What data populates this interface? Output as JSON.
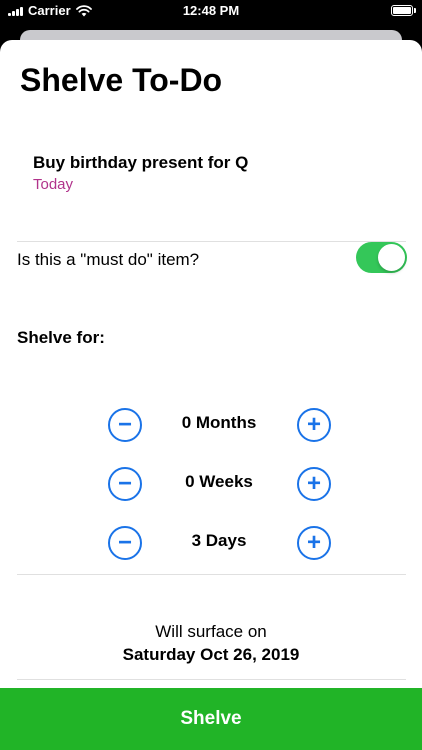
{
  "status_bar": {
    "carrier": "Carrier",
    "time": "12:48 PM"
  },
  "title": "Shelve To-Do",
  "todo": {
    "name": "Buy birthday present for Q",
    "date": "Today"
  },
  "must_do": {
    "label": "Is this a \"must do\" item?",
    "enabled": true
  },
  "shelve_for": {
    "label": "Shelve for:",
    "steppers": [
      {
        "value": "0 Months",
        "minus": "−",
        "plus": "+"
      },
      {
        "value": "0 Weeks",
        "minus": "−",
        "plus": "+"
      },
      {
        "value": "3 Days",
        "minus": "−",
        "plus": "+"
      }
    ]
  },
  "surface": {
    "line1": "Will surface on",
    "line2": "Saturday Oct 26, 2019"
  },
  "action": {
    "shelve_label": "Shelve"
  },
  "colors": {
    "accent": "#1a73e8",
    "toggle_on": "#34c759",
    "date": "#b1338b",
    "button": "#21b427"
  }
}
